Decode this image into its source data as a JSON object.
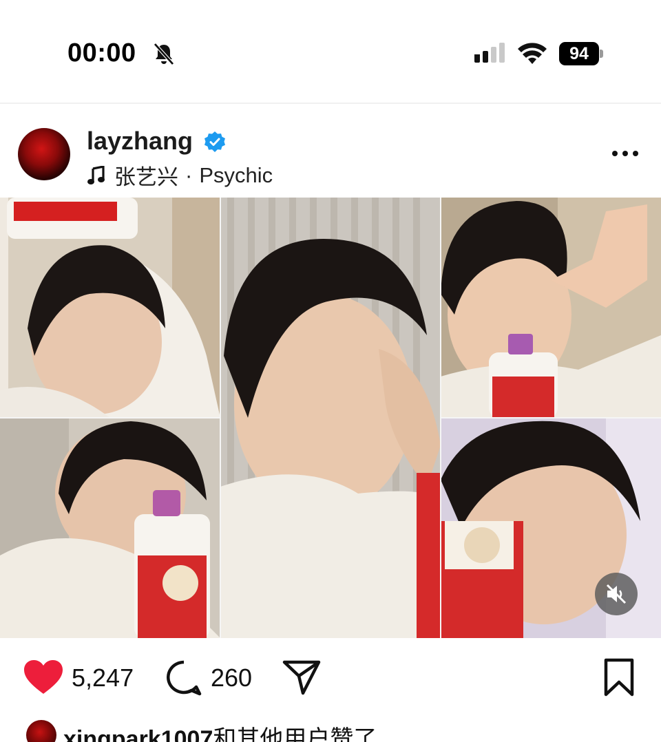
{
  "status_bar": {
    "time": "00:00",
    "battery": "94",
    "icons": [
      "bell-off-icon",
      "cellular-signal-icon",
      "wifi-icon",
      "battery-icon"
    ]
  },
  "post": {
    "username": "layzhang",
    "verified": true,
    "audio": {
      "artist": "张艺兴",
      "separator": "·",
      "track": "Psychic"
    },
    "more_icon": "more-horizontal-icon",
    "media": {
      "layout": "collage-5-photos",
      "muted": true,
      "mute_icon": "volume-muted-icon"
    },
    "actions": {
      "liked": true,
      "like_count": "5,247",
      "comment_count": "260",
      "icons": [
        "heart-icon",
        "comment-icon",
        "share-icon",
        "bookmark-icon"
      ]
    },
    "liked_by": {
      "user": "xingpark1007",
      "text": "和其他用户赞了"
    }
  },
  "colors": {
    "like_red": "#ed1e3b",
    "verified_blue": "#1d9bf0",
    "text": "#111111"
  }
}
